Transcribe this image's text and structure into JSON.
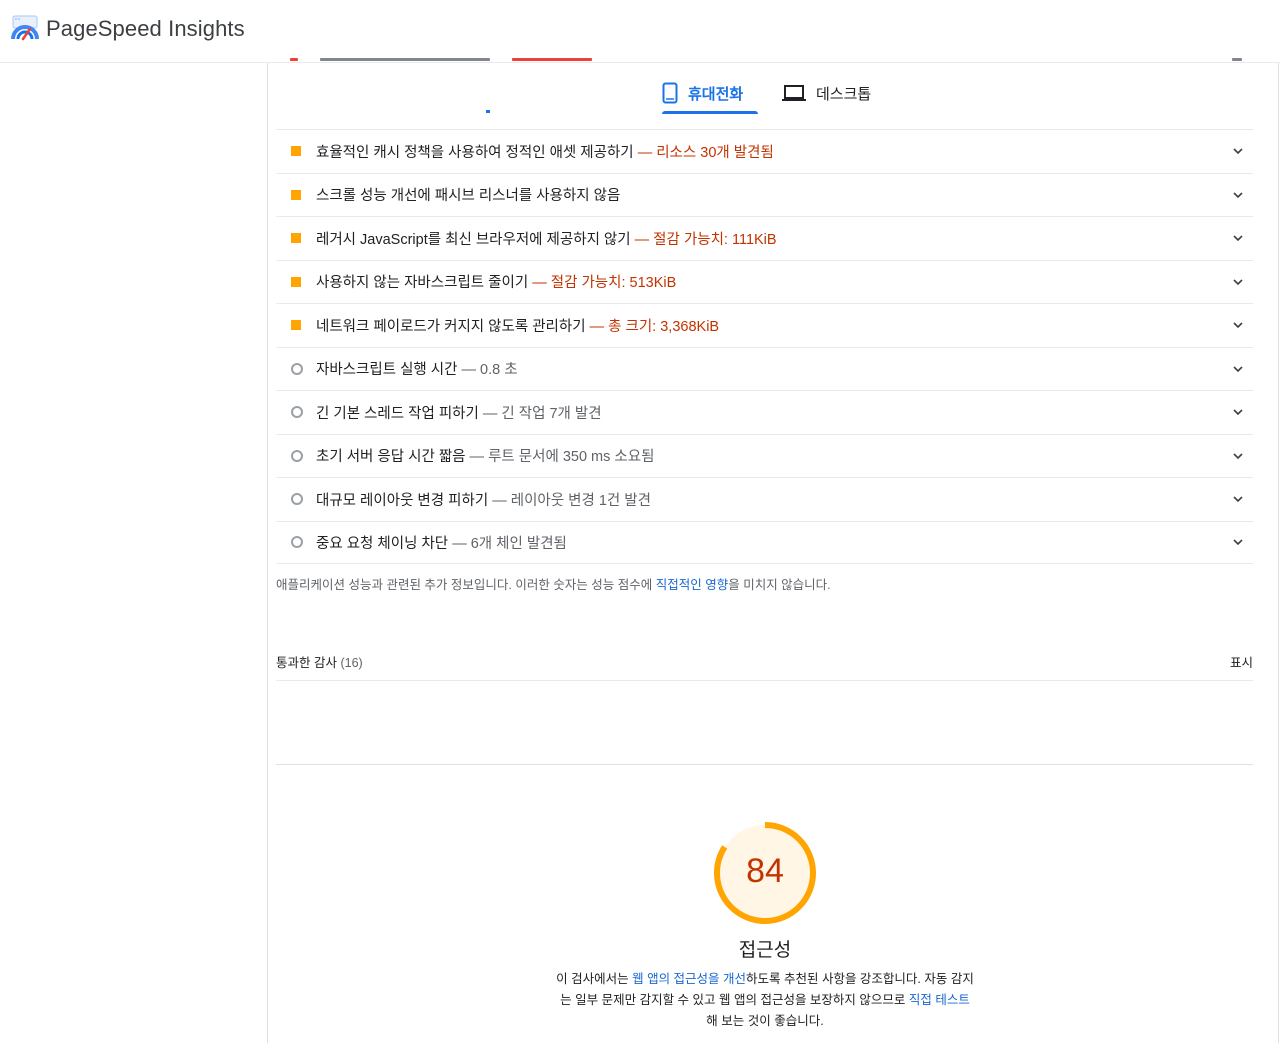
{
  "header": {
    "brand": "PageSpeed Insights"
  },
  "tabs": {
    "mobile": "휴대전화",
    "desktop": "데스크톱"
  },
  "audits": [
    {
      "type": "warn",
      "title": "효율적인 캐시 정책을 사용하여 정적인 애셋 제공하기",
      "detail": "— 리소스 30개 발견됨"
    },
    {
      "type": "warn",
      "title": "스크롤 성능 개선에 패시브 리스너를 사용하지 않음",
      "detail": ""
    },
    {
      "type": "warn",
      "title": "레거시 JavaScript를 최신 브라우저에 제공하지 않기",
      "detail": "— 절감 가능치: 111KiB"
    },
    {
      "type": "warn",
      "title": "사용하지 않는 자바스크립트 줄이기",
      "detail": "— 절감 가능치: 513KiB"
    },
    {
      "type": "warn",
      "title": "네트워크 페이로드가 커지지 않도록 관리하기",
      "detail": "— 총 크기: 3,368KiB"
    },
    {
      "type": "info",
      "title": "자바스크립트 실행 시간",
      "detail": "— 0.8 초"
    },
    {
      "type": "info",
      "title": "긴 기본 스레드 작업 피하기",
      "detail": "— 긴 작업 7개 발견"
    },
    {
      "type": "info",
      "title": "초기 서버 응답 시간 짧음",
      "detail": "— 루트 문서에 350 ms 소요됨"
    },
    {
      "type": "info",
      "title": "대규모 레이아웃 변경 피하기",
      "detail": "— 레이아웃 변경 1건 발견"
    },
    {
      "type": "info",
      "title": "중요 요청 체이닝 차단",
      "detail": "— 6개 체인 발견됨"
    }
  ],
  "note": {
    "before": "애플리케이션 성능과 관련된 추가 정보입니다. 이러한 숫자는 성능 점수에 ",
    "link": "직접적인 영향",
    "after": "을 미치지 않습니다."
  },
  "passed": {
    "label": "통과한 감사",
    "count": "(16)",
    "show": "표시"
  },
  "accessibility": {
    "score": "84",
    "score_value": 84,
    "title": "접근성",
    "desc_before": "이 검사에서는 ",
    "desc_link1": "웹 앱의 접근성을 개선",
    "desc_middle": "하도록 추천된 사항을 강조합니다. 자동 감지는 일부 문제만 감지할 수 있고 웹 앱의 접근성을 보장하지 않으므로 ",
    "desc_link2": "직접 테스트",
    "desc_after": "해 보는 것이 좋습니다."
  },
  "colors": {
    "warn": "#ffa400",
    "fail_text": "#c33300",
    "link": "#1967d2",
    "accent": "#1a73e8"
  }
}
